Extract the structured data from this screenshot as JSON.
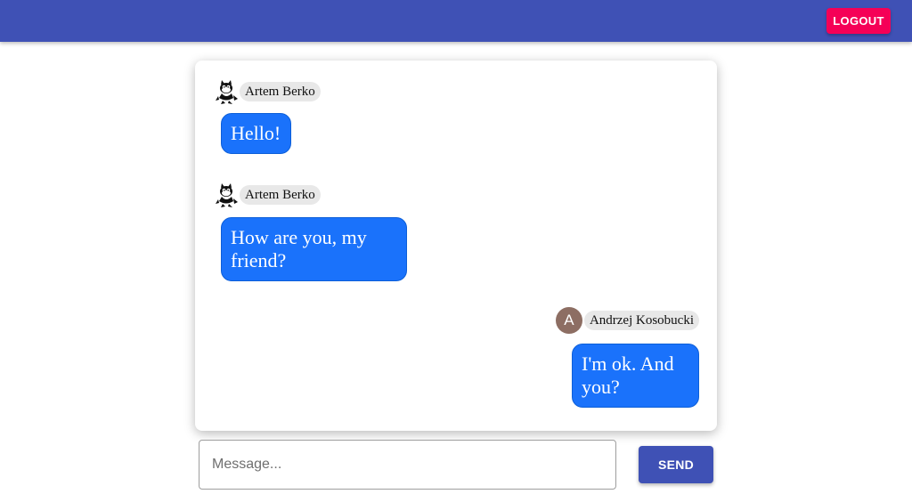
{
  "header": {
    "logout_label": "LOGOUT",
    "bar_color": "#3f51b5",
    "logout_color": "#f50057"
  },
  "messages": [
    {
      "sender": "Artem Berko",
      "avatar": "cartoon-cat-icon",
      "text": "Hello!",
      "own": false
    },
    {
      "sender": "Artem Berko",
      "avatar": "cartoon-cat-icon",
      "text": "How are you, my friend?",
      "own": false
    },
    {
      "sender": "Andrzej Kosobucki",
      "avatar_letter": "A",
      "text": "I'm ok. And you?",
      "own": true
    }
  ],
  "composer": {
    "placeholder": "Message...",
    "value": "",
    "send_label": "SEND"
  },
  "colors": {
    "bubble": "#1a72fb",
    "send_button": "#3f51b5",
    "avatar_letter_bg": "#8d6e63"
  }
}
